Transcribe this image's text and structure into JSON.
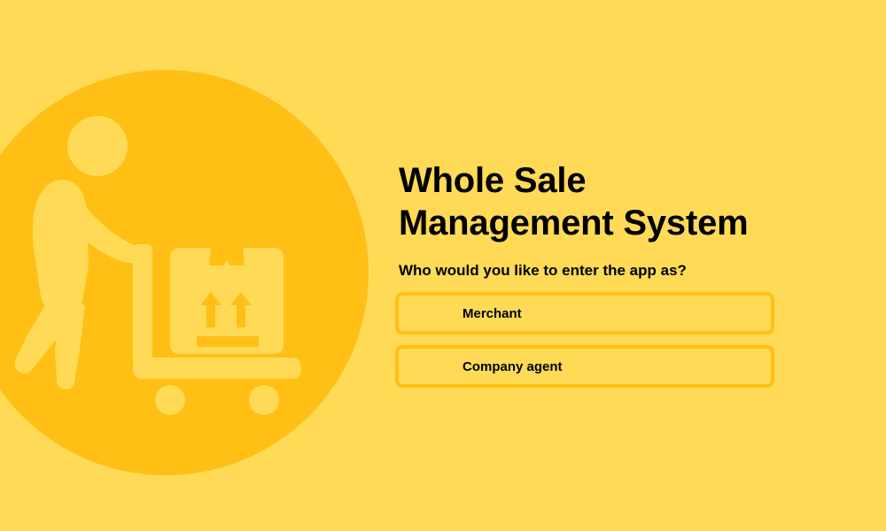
{
  "app": {
    "title_line1": "Whole Sale",
    "title_line2": "Management System"
  },
  "prompt": "Who would you like to enter the app as?",
  "roles": [
    {
      "label": "Merchant"
    },
    {
      "label": "Company agent"
    }
  ],
  "colors": {
    "background": "#FFDA56",
    "accent": "#FFBF14",
    "text": "#000000"
  },
  "illustration": {
    "icon": "delivery-worker-cart-icon"
  }
}
